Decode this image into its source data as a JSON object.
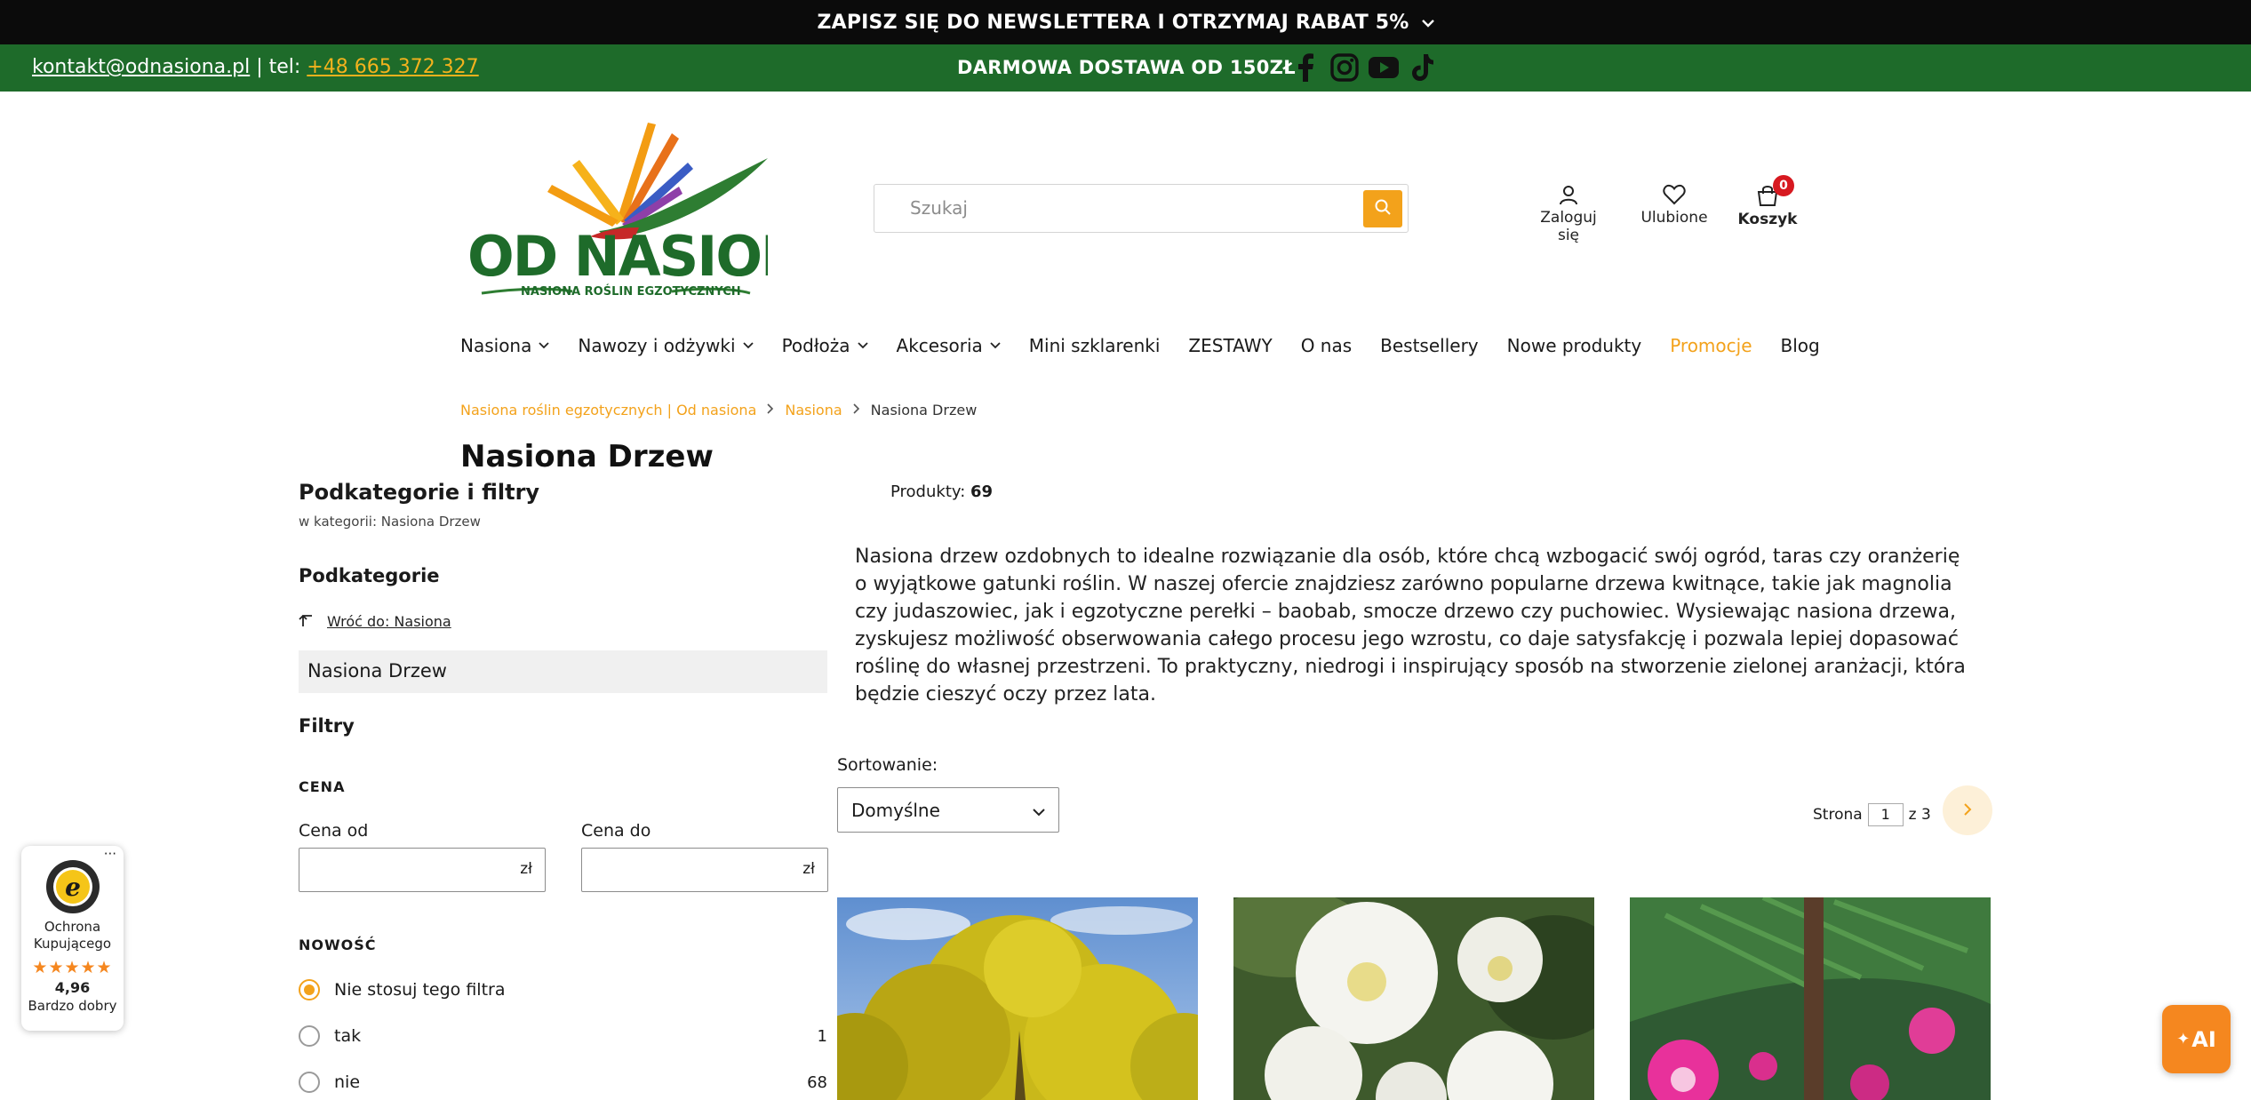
{
  "announcement": {
    "text": "ZAPISZ SIĘ DO NEWSLETTERA I OTRZYMAJ RABAT 5%"
  },
  "contact_bar": {
    "email": "kontakt@odnasiona.pl",
    "separator": " | tel: ",
    "phone": "+48 665 372 327",
    "free_shipping": "DARMOWA DOSTAWA OD 150ZŁ",
    "socials": [
      "facebook-icon",
      "instagram-icon",
      "youtube-icon",
      "tiktok-icon"
    ]
  },
  "logo": {
    "name": "OD NASIONA",
    "tagline": "NASIONA ROŚLIN EGZOTYCZNYCH"
  },
  "search": {
    "placeholder": "Szukaj"
  },
  "header_actions": {
    "login": "Zaloguj się",
    "favorites": "Ulubione",
    "cart": "Koszyk",
    "cart_count": "0"
  },
  "nav": {
    "items": [
      {
        "label": "Nasiona",
        "dropdown": true
      },
      {
        "label": "Nawozy i odżywki",
        "dropdown": true
      },
      {
        "label": "Podłoża",
        "dropdown": true
      },
      {
        "label": "Akcesoria",
        "dropdown": true
      },
      {
        "label": "Mini szklarenki",
        "dropdown": false
      },
      {
        "label": "ZESTAWY",
        "dropdown": false
      },
      {
        "label": "O nas",
        "dropdown": false
      },
      {
        "label": "Bestsellery",
        "dropdown": false
      },
      {
        "label": "Nowe produkty",
        "dropdown": false
      },
      {
        "label": "Promocje",
        "dropdown": false
      },
      {
        "label": "Blog",
        "dropdown": false
      }
    ]
  },
  "breadcrumb": {
    "home": "Nasiona roślin egzotycznych | Od nasiona",
    "parent": "Nasiona",
    "current": "Nasiona Drzew"
  },
  "page": {
    "title": "Nasiona Drzew"
  },
  "sidebar": {
    "title": "Podkategorie i filtry",
    "subtitle": "w kategorii: Nasiona Drzew",
    "subcategories_heading": "Podkategorie",
    "back_link": "Wróć do: Nasiona",
    "active_subcategory": "Nasiona Drzew",
    "filters_heading": "Filtry",
    "price_heading": "CENA",
    "price_from_label": "Cena od",
    "price_to_label": "Cena do",
    "currency": "zł",
    "new_heading": "NOWOŚĆ",
    "new_options": [
      {
        "label": "Nie stosuj tego filtra",
        "count": "",
        "selected": true
      },
      {
        "label": "tak",
        "count": "1",
        "selected": false
      },
      {
        "label": "nie",
        "count": "68",
        "selected": false
      }
    ]
  },
  "listing": {
    "products_label": "Produkty:",
    "products_count": "69",
    "description": "Nasiona drzew ozdobnych to idealne rozwiązanie dla osób, które chcą wzbogacić swój ogród, taras czy oranżerię o wyjątkowe gatunki roślin. W naszej ofercie znajdziesz zarówno popularne drzewa kwitnące, takie jak magnolia czy judaszowiec, jak i egzotyczne perełki – baobab, smocze drzewo czy puchowiec. Wysiewając nasiona drzewa, zyskujesz możliwość obserwowania całego procesu jego wzrostu, co daje satysfakcję i pozwala lepiej dopasować roślinę do własnej przestrzeni. To praktyczny, niedrogi i inspirujący sposób na stworzenie zielonej aranżacji, która będzie cieszyć oczy przez lata.",
    "sort_label": "Sortowanie:",
    "sort_value": "Domyślne",
    "page_label": "Strona",
    "page_current": "1",
    "page_total": "z 3"
  },
  "trusted_shops": {
    "label": "Ochrona Kupującego",
    "score": "4,96",
    "rating": "Bardzo dobry"
  },
  "ai_button": {
    "label": "AI"
  },
  "colors": {
    "brand_green": "#1e6b2a",
    "accent_orange": "#f3a21b",
    "topbar": "#0b0b0b"
  }
}
